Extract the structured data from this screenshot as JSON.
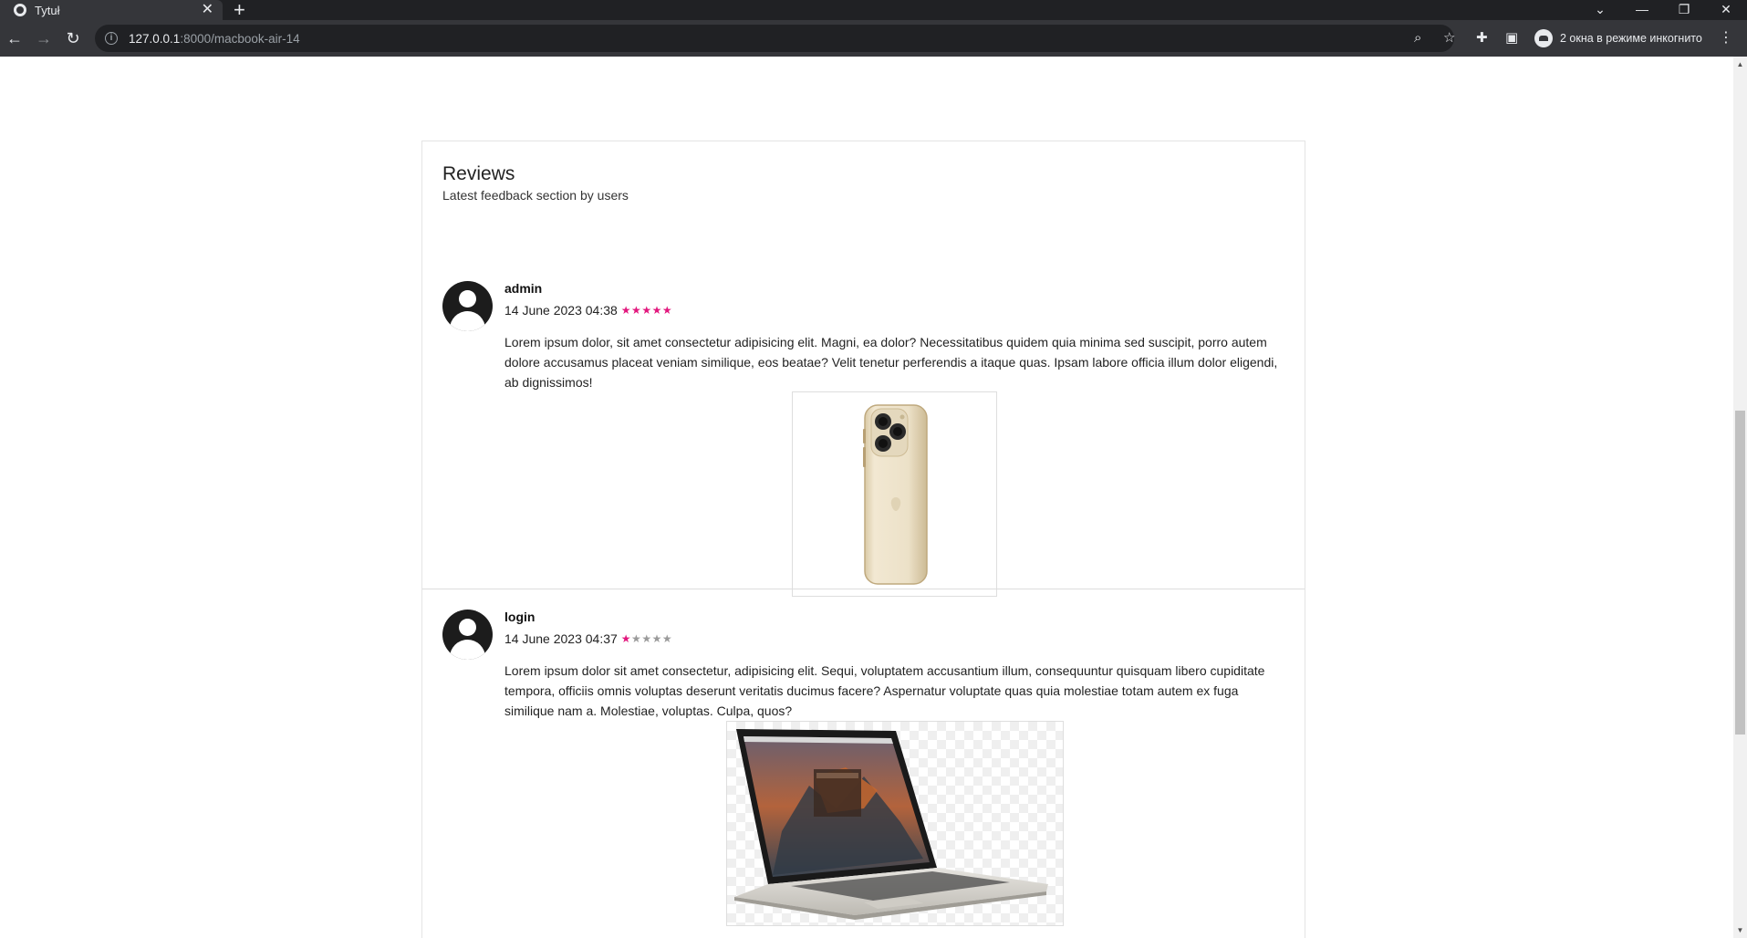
{
  "browser": {
    "tab_title": "Tytuł",
    "url_host": "127.0.0.1",
    "url_rest": ":8000/macbook-air-14",
    "incognito_label": "2 окна в режиме инкогнито",
    "accent": "#35363a"
  },
  "reviews_section": {
    "title": "Reviews",
    "subtitle": "Latest feedback section by users",
    "reviews": [
      {
        "user": "admin",
        "date": "14 June 2023 04:38",
        "rating": 5,
        "rating_max": 5,
        "text": "Lorem ipsum dolor, sit amet consectetur adipisicing elit. Magni, ea dolor? Necessitatibus quidem quia minima sed suscipit, porro autem dolore accusamus placeat veniam similique, eos beatae? Velit tenetur perferendis a itaque quas. Ipsam labore officia illum dolor eligendi, ab dignissimos!",
        "image": "gold-phone-image"
      },
      {
        "user": "login",
        "date": "14 June 2023 04:37",
        "rating": 1,
        "rating_max": 5,
        "text": "Lorem ipsum dolor sit amet consectetur, adipisicing elit. Sequi, voluptatem accusantium illum, consequuntur quisquam libero cupiditate tempora, officiis omnis voluptas deserunt veritatis ducimus facere? Aspernatur voluptate quas quia molestiae totam autem ex fuga similique nam a. Molestiae, voluptas. Culpa, quos?",
        "image": "laptop-image"
      }
    ]
  },
  "colors": {
    "star_active": "#e2177d",
    "star_inactive": "#9a9a9a"
  }
}
